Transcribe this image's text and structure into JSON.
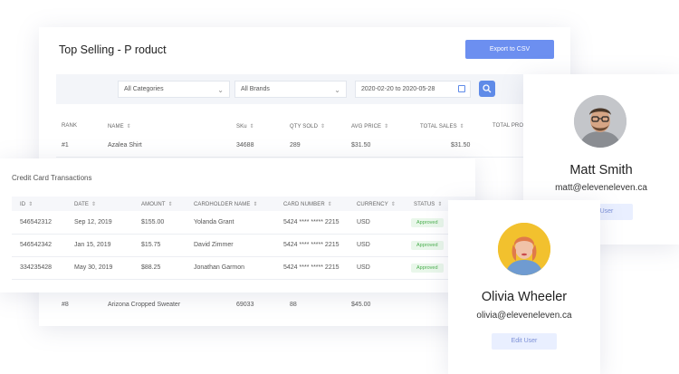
{
  "main": {
    "title": "Top Selling - P roduct",
    "export_label": "Export to CSV",
    "filters": {
      "category": "All Categories",
      "brand": "All Brands",
      "date_range": "2020-02-20 to 2020-05-28"
    },
    "columns": [
      "RANK",
      "NAME",
      "SKu",
      "QTY SOLD",
      "AVG PRICE",
      "TOTAL SALES",
      "TOTAL PRO"
    ],
    "rows": [
      {
        "rank": "#1",
        "name": "Azalea Shirt",
        "sku": "34688",
        "qty": "289",
        "avg": "$31.50",
        "total": "$31.50"
      },
      {
        "rank": "#8",
        "name": "Arizona Cropped Sweater",
        "sku": "69033",
        "qty": "88",
        "avg": "$45.00",
        "total": ""
      }
    ]
  },
  "cc": {
    "title": "Credit Card Transactions",
    "columns": [
      "ID",
      "DATE",
      "AMOUNT",
      "CARDHOLDER NAME",
      "CARD NUMBER",
      "CURRENCY",
      "STATUS"
    ],
    "rows": [
      {
        "id": "546542312",
        "date": "Sep 12, 2019",
        "amount": "$155.00",
        "name": "Yolanda Grant",
        "card": "5424 **** ***** 2215",
        "currency": "USD",
        "status": "Approved"
      },
      {
        "id": "546542342",
        "date": "Jan 15, 2019",
        "amount": "$15.75",
        "name": "David Zimmer",
        "card": "5424 **** ***** 2215",
        "currency": "USD",
        "status": "Approved"
      },
      {
        "id": "334235428",
        "date": "May 30, 2019",
        "amount": "$88.25",
        "name": "Jonathan Garmon",
        "card": "5424 **** ***** 2215",
        "currency": "USD",
        "status": "Approved"
      }
    ]
  },
  "users": {
    "matt": {
      "name": "Matt Smith",
      "email": "matt@eleveneleven.ca",
      "edit_label": "User"
    },
    "olivia": {
      "name": "Olivia Wheeler",
      "email": "olivia@eleveneleven.ca",
      "edit_label": "Edit User"
    }
  },
  "colors": {
    "accent": "#6c8ff0",
    "approved": "#4caf50",
    "approved_bg": "#e9f7ea"
  }
}
